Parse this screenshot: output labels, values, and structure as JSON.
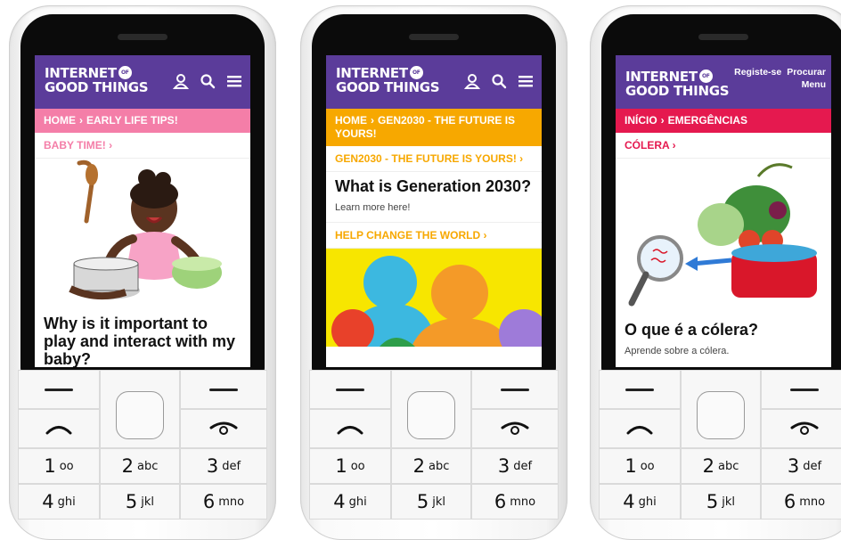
{
  "logo": {
    "line1": "INTERNET",
    "of": "OF",
    "line2": "GOOD THINGS"
  },
  "phone1": {
    "breadcrumb": {
      "home": "HOME",
      "current": "EARLY LIFE TIPS!"
    },
    "subnav": "BABY TIME!",
    "title": "Why is it important to play and interact with my baby?"
  },
  "phone2": {
    "breadcrumb": {
      "home": "HOME",
      "current": "GEN2030 - THE FUTURE IS YOURS!"
    },
    "subnav": "GEN2030 - THE FUTURE IS YOURS!",
    "title": "What is Generation 2030?",
    "body": "Learn more here!",
    "link": "HELP CHANGE THE WORLD"
  },
  "phone3": {
    "nav": {
      "register": "Registe-se",
      "search": "Procurar",
      "menu": "Menu"
    },
    "breadcrumb": {
      "home": "INÍCIO",
      "current": "EMERGÊNCIAS"
    },
    "subnav": "CÓLERA",
    "title": "O que é a cólera?",
    "body": "Aprende sobre a cólera."
  },
  "keypad": {
    "k1": {
      "num": "1",
      "let": "oo"
    },
    "k2": {
      "num": "2",
      "let": "abc"
    },
    "k3": {
      "num": "3",
      "let": "def"
    },
    "k4": {
      "num": "4",
      "let": "ghi"
    },
    "k5": {
      "num": "5",
      "let": "jkl"
    },
    "k6": {
      "num": "6",
      "let": "mno"
    }
  },
  "colors": {
    "header": "#5b3c9a",
    "phone1_accent": "#f47ea8",
    "phone2_accent": "#f7a800",
    "phone3_accent": "#e5194f"
  }
}
